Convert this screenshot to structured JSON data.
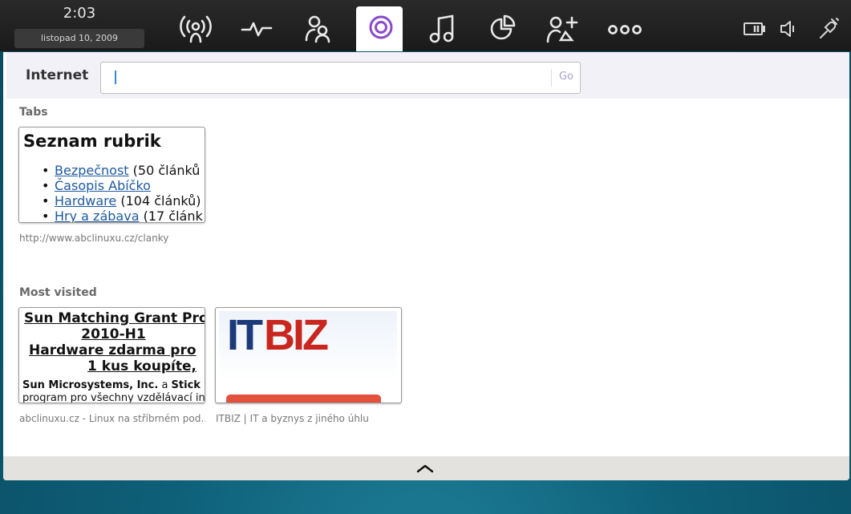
{
  "status": {
    "time": "2:03",
    "date": "listopad 10, 2009"
  },
  "nav": {
    "items": [
      {
        "icon": "broadcast-icon"
      },
      {
        "icon": "activity-icon"
      },
      {
        "icon": "contacts-icon"
      },
      {
        "icon": "browser-icon",
        "active": true
      },
      {
        "icon": "music-icon"
      },
      {
        "icon": "pie-chart-icon"
      },
      {
        "icon": "add-contact-icon"
      },
      {
        "icon": "more-icon"
      }
    ]
  },
  "system_icons": [
    "battery-icon",
    "volume-icon",
    "network-icon"
  ],
  "browser": {
    "label": "Internet",
    "url_value": "",
    "go_label": "Go"
  },
  "tabs": {
    "title": "Tabs",
    "items": [
      {
        "heading": "Seznam rubrik",
        "links": [
          {
            "text": "Bezpečnost",
            "suffix": " (50 článků"
          },
          {
            "text": "Časopis Abíčko",
            "suffix": ""
          },
          {
            "text": "Hardware",
            "suffix": " (104 článků)"
          },
          {
            "text": "Hry a zábava",
            "suffix": " (17 článk"
          }
        ],
        "caption": "http://www.abclinuxu.cz/clanky"
      }
    ]
  },
  "most_visited": {
    "title": "Most visited",
    "items": [
      {
        "title_lines": [
          "Sun Matching Grant Pro",
          "2010-H1",
          "Hardware zdarma pro",
          "1 kus koupíte,"
        ],
        "body_bold": "Sun Microsystems, Inc.",
        "body_mid": " a ",
        "body_bold2": "Stick",
        "body_line2": "program pro všechny vzdělávací in",
        "caption": "abclinuxu.cz - Linux na stříbrném pod..."
      },
      {
        "logo_text": "ITBIZ",
        "caption": "ITBIZ | IT a byznys z jiného úhlu"
      }
    ]
  },
  "colors": {
    "active_icon": "#8a4bc8",
    "link": "#1e5aa0",
    "itbiz_blue": "#1c3a7a",
    "itbiz_red": "#c8261e"
  }
}
